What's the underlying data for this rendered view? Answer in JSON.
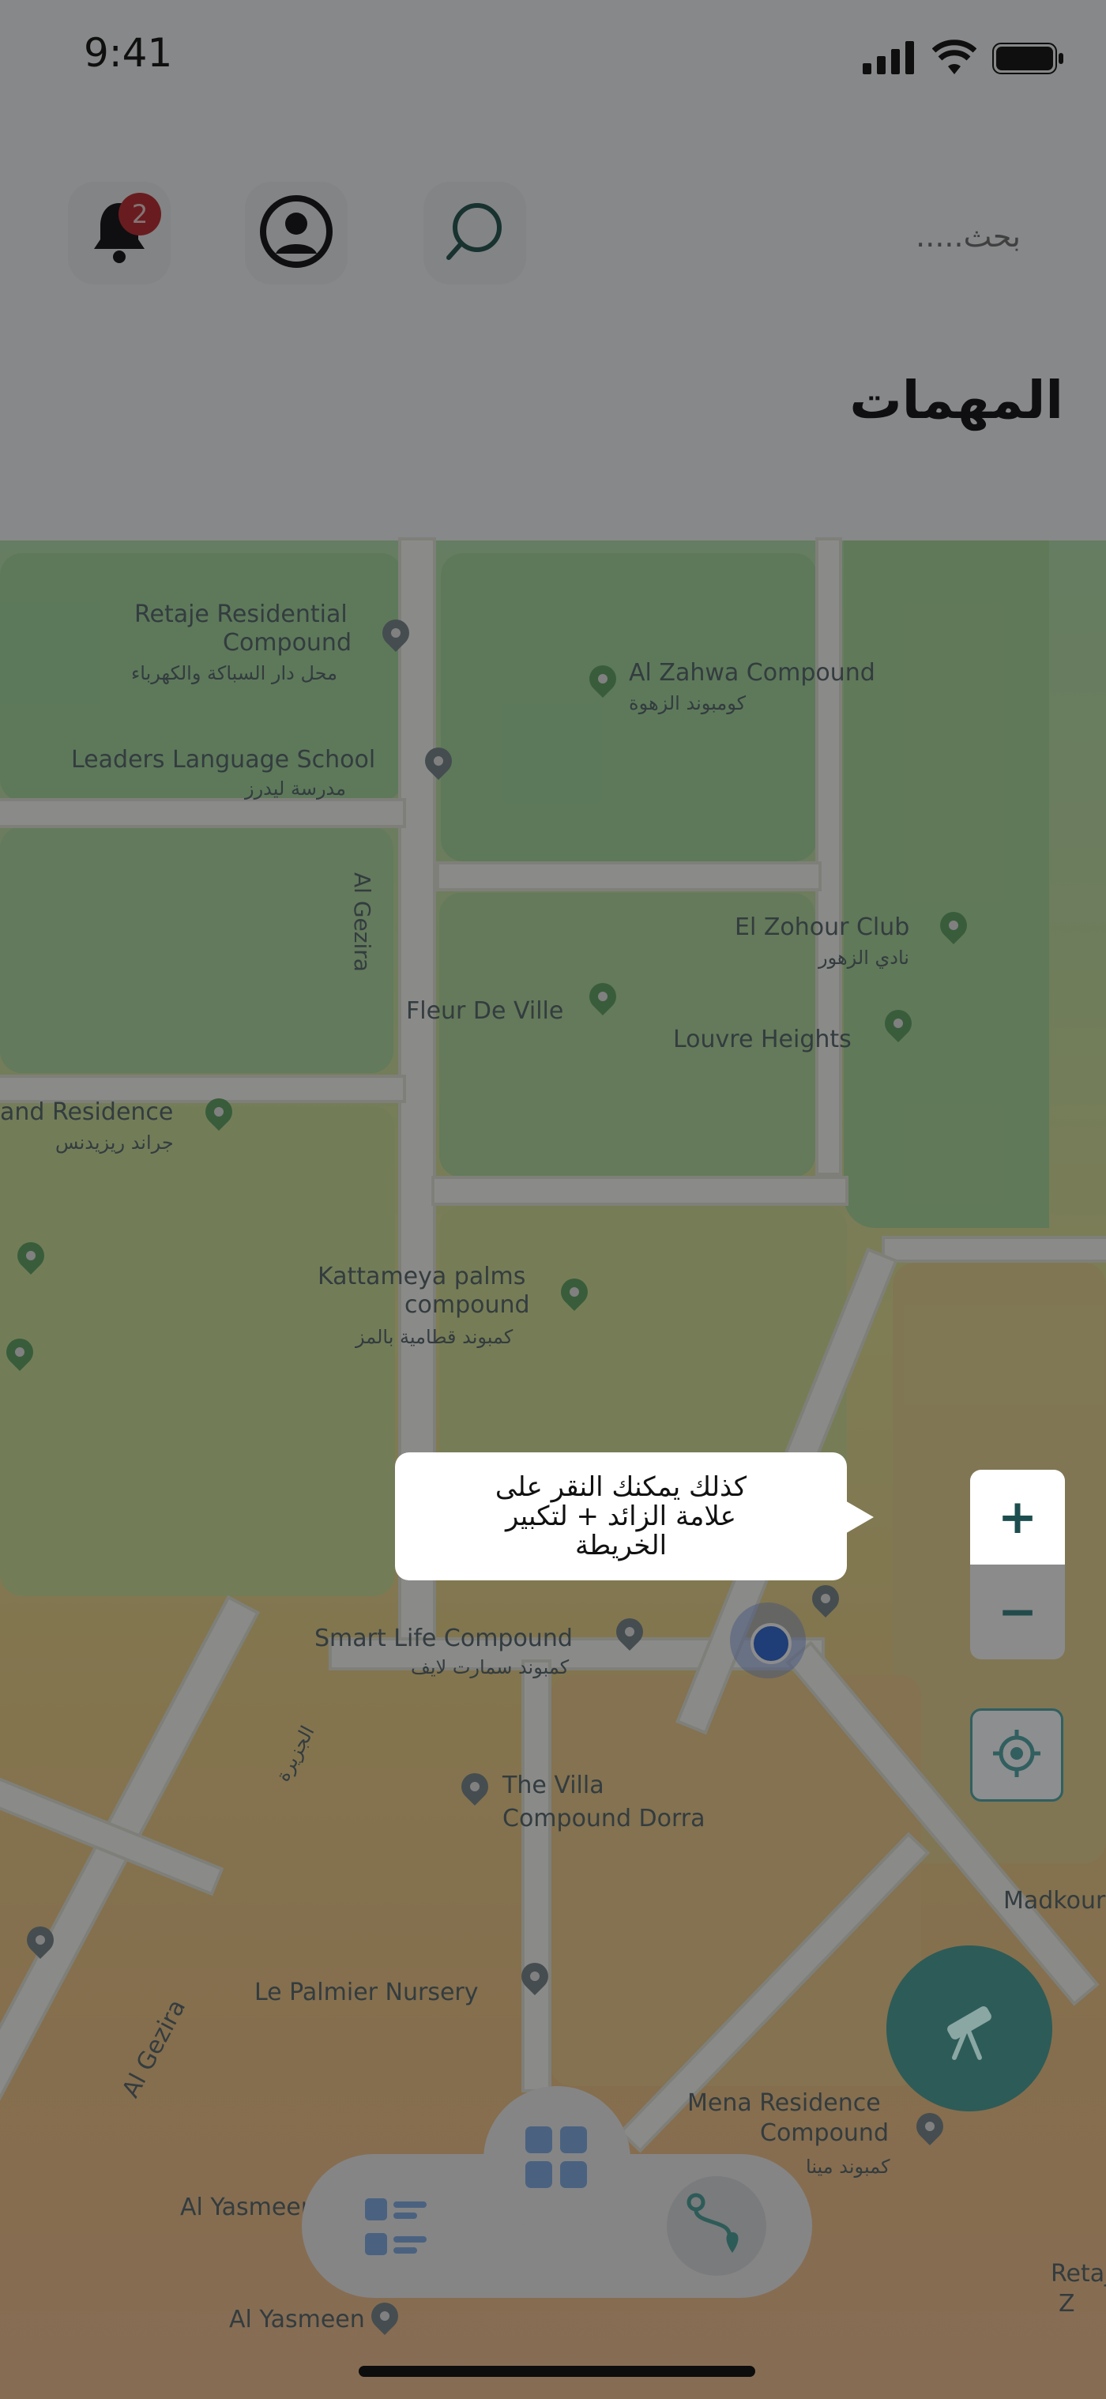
{
  "status_bar": {
    "time": "9:41"
  },
  "header": {
    "search_placeholder": "بحث.....",
    "notification_count": "2",
    "page_title": "المهمات"
  },
  "map": {
    "labels": [
      {
        "text": "Retaje Residential"
      },
      {
        "text": "Compound"
      },
      {
        "text": "محل دار السباكة والكهرباء"
      },
      {
        "text": "Al Zahwa Compound"
      },
      {
        "text": "كومبوند الزهوة"
      },
      {
        "text": "Leaders Language School"
      },
      {
        "text": "مدرسة ليدرز"
      },
      {
        "text": "Al Gezira"
      },
      {
        "text": "El Zohour Club"
      },
      {
        "text": "نادي الزهور"
      },
      {
        "text": "Fleur De Ville"
      },
      {
        "text": "Louvre Heights"
      },
      {
        "text": "and Residence"
      },
      {
        "text": "جراند ريزيدنس"
      },
      {
        "text": "Kattameya palms"
      },
      {
        "text": "compound"
      },
      {
        "text": "كمبوند قطامية بالمز"
      },
      {
        "text": "Smart Life Compound"
      },
      {
        "text": "كمبوند سمارت لايف"
      },
      {
        "text": "الجزيرة"
      },
      {
        "text": "The Villa"
      },
      {
        "text": "Compound Dorra"
      },
      {
        "text": "Madkour"
      },
      {
        "text": "Le Palmier Nursery"
      },
      {
        "text": "Al Gezira"
      },
      {
        "text": "Mena Residence"
      },
      {
        "text": "Compound"
      },
      {
        "text": "كمبوند مينا"
      },
      {
        "text": "Al Yasmeen"
      },
      {
        "text": "Al Yasmeen"
      },
      {
        "text": "Retaj"
      },
      {
        "text": "Z"
      }
    ]
  },
  "tooltip": {
    "text": "كذلك يمكنك النقر على علامة الزائد + لتكبير الخريطة"
  },
  "zoom": {
    "in_label": "+",
    "out_label": "−"
  },
  "colors": {
    "accent": "#2d5b58",
    "badge": "#c0343a",
    "overlay": "rgba(0,0,0,0.45)"
  },
  "icons": {
    "notifications": "bell-icon",
    "profile": "user-circle-icon",
    "search": "search-icon",
    "locate": "locate-icon",
    "fab": "telescope-icon",
    "nav_list": "list-icon",
    "nav_grid": "grid-icon",
    "nav_route": "route-icon"
  }
}
